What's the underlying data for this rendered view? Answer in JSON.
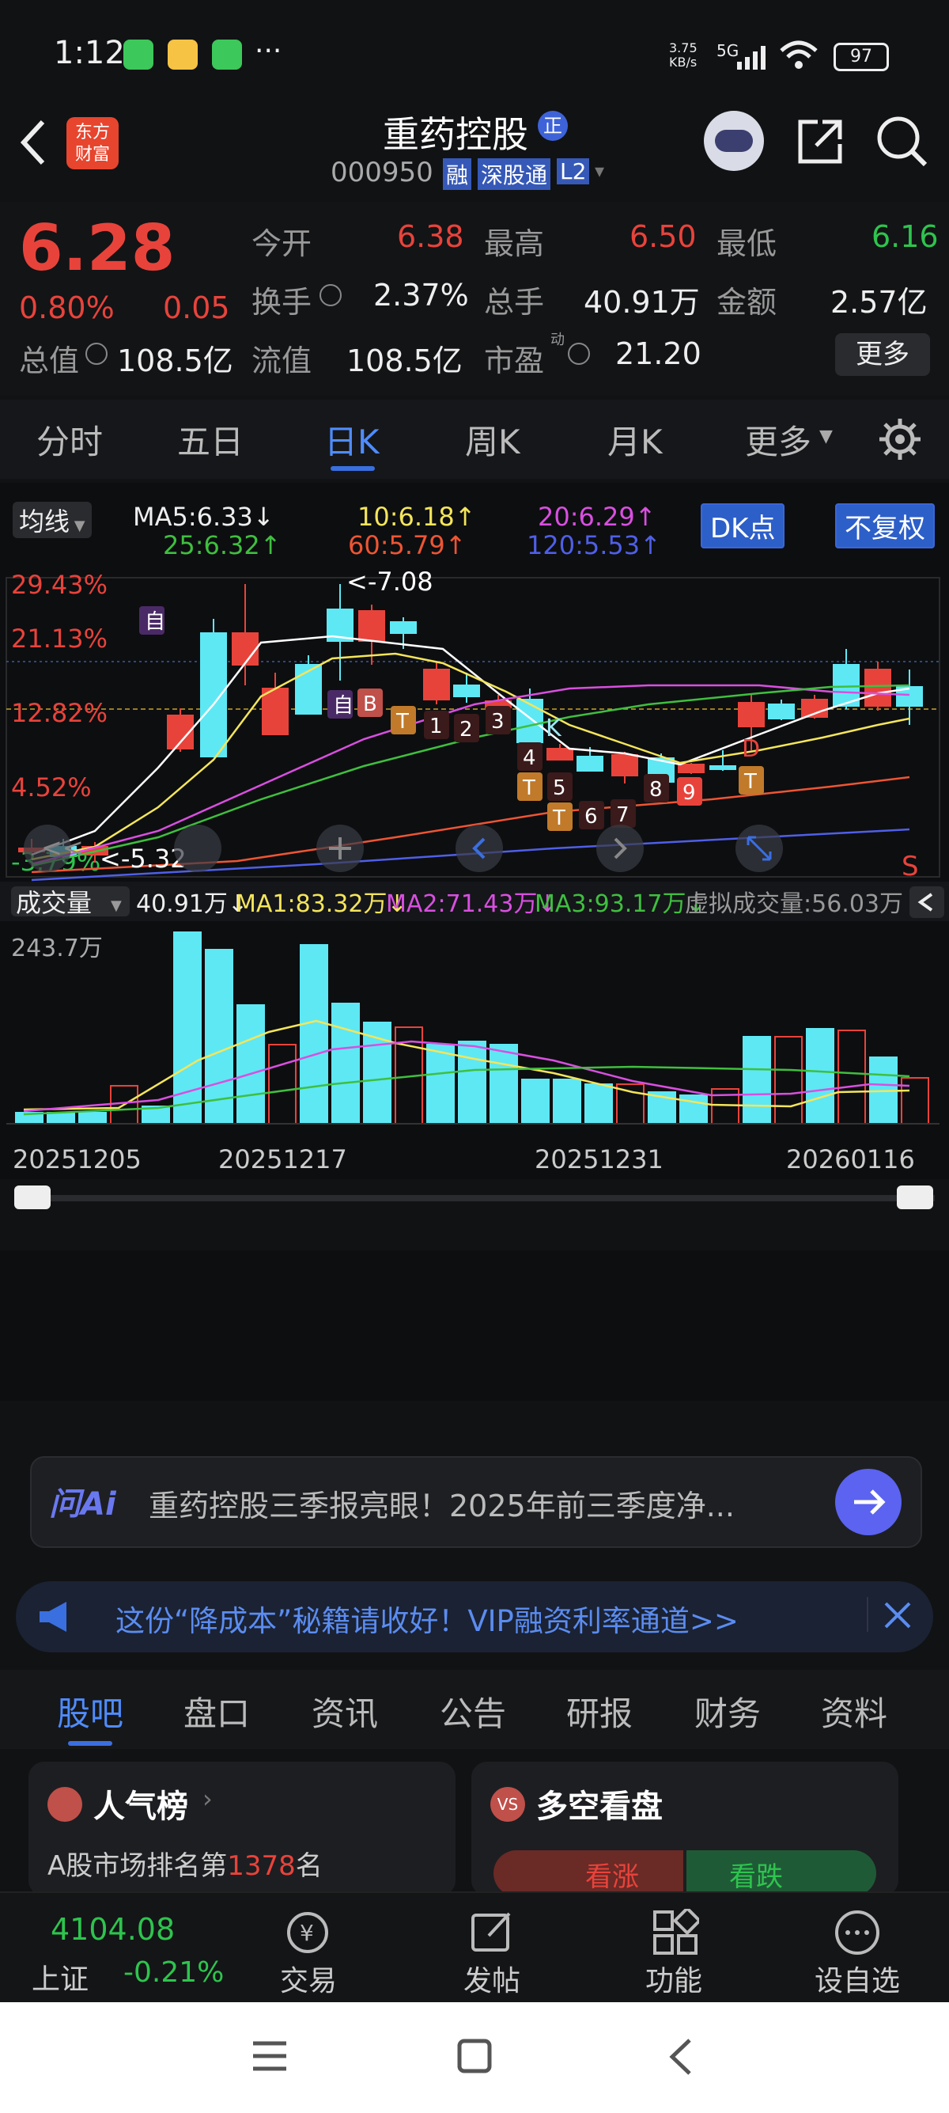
{
  "status": {
    "time": "1:12",
    "speed": "3.75\nKB/s",
    "network": "5G",
    "battery": "97"
  },
  "header": {
    "broker_logo_top": "东方",
    "broker_logo_bottom": "财富",
    "stock_name": "重药控股",
    "name_badge": "正",
    "code": "000950",
    "tag_margin": "融",
    "tag_connect": "深股通",
    "tag_level": "L2"
  },
  "quote": {
    "price": "6.28",
    "change_pct": "0.80%",
    "change": "0.05",
    "open_label": "今开",
    "open": "6.38",
    "high_label": "最高",
    "high": "6.50",
    "low_label": "最低",
    "low": "6.16",
    "turnover_label": "换手",
    "turnover": "2.37%",
    "volume_label": "总手",
    "volume": "40.91万",
    "amount_label": "金额",
    "amount": "2.57亿",
    "mktcap_label": "总值",
    "mktcap": "108.5亿",
    "float_label": "流值",
    "float": "108.5亿",
    "pe_label": "市盈",
    "pe_super": "动",
    "pe": "21.20",
    "more_button": "更多"
  },
  "chart_tabs": [
    "分时",
    "五日",
    "日K",
    "周K",
    "月K",
    "更多"
  ],
  "ma_bar": {
    "selector": "均线",
    "ma5": "MA5:6.33↓",
    "ma10": "10:6.18↑",
    "ma20": "20:6.29↑",
    "ma25": "25:6.32↑",
    "ma60": "60:5.79↑",
    "ma120": "120:5.53↑",
    "dk_button": "DK点",
    "adjust_button": "不复权"
  },
  "price_axis": [
    "29.43%",
    "21.13%",
    "12.82%",
    "4.52%",
    "-3.79%"
  ],
  "annotations": {
    "high": "<-7.08",
    "low": "<-5.32",
    "self_mark": "自",
    "b_mark": "B",
    "k_mark": "K",
    "d_mark": "D",
    "t_mark": "T",
    "s_mark": "S"
  },
  "volume_bar": {
    "selector": "成交量",
    "vol": "40.91万↓",
    "ma1": "MA1:83.32万↓",
    "ma2": "MA2:71.43万↓",
    "ma3": "MA3:93.17万↓",
    "virtual": "虚拟成交量:56.03万",
    "max": "243.7万"
  },
  "dates": [
    "20251205",
    "20251217",
    "20251231",
    "20260116"
  ],
  "ai_bar": {
    "logo": "问Ai",
    "text": "重药控股三季报亮眼！2025年前三季度净..."
  },
  "vip_bar": {
    "text": "这份“降成本”秘籍请收好！VIP融资利率通道>>"
  },
  "bottom_tabs": [
    "股吧",
    "盘口",
    "资讯",
    "公告",
    "研报",
    "财务",
    "资料"
  ],
  "cards": {
    "popularity_title": "人气榜",
    "popularity_text_pre": "A股市场排名第",
    "popularity_rank": "1378",
    "popularity_text_post": "名",
    "bull_bear_title": "多空看盘",
    "bull": "看涨",
    "bear": "看跌"
  },
  "index": {
    "value": "4104.08",
    "name": "上证",
    "change": "-0.21%"
  },
  "nav": [
    "交易",
    "发帖",
    "功能",
    "设自选"
  ]
}
